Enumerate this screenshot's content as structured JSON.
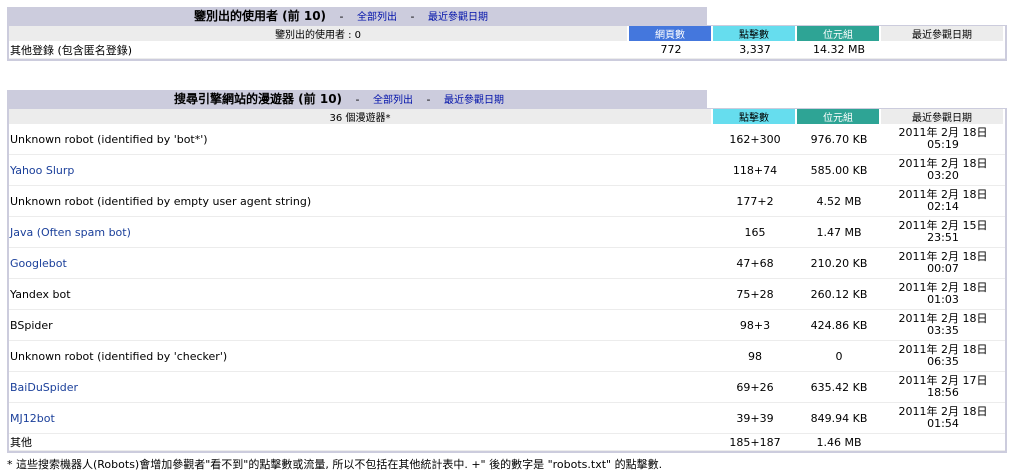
{
  "users_section": {
    "title": "鑒別出的使用者 (前 10)",
    "sep1": "-",
    "link_full": "全部列出",
    "sep2": "-",
    "link_last": "最近參觀日期",
    "header_label": "鑒別出的使用者 : 0",
    "col_pages": "網頁數",
    "col_hits": "點擊數",
    "col_bandwidth": "位元組",
    "col_last": "最近參觀日期",
    "other_row": {
      "label": "其他登錄 (包含匿名登錄)",
      "pages": "772",
      "hits": "3,337",
      "bandwidth": "14.32 MB",
      "last": ""
    }
  },
  "robots_section": {
    "title": "搜尋引擎網站的漫遊器 (前 10)",
    "sep1": "-",
    "link_full": "全部列出",
    "sep2": "-",
    "link_last": "最近參觀日期",
    "header_label": "36 個漫遊器*",
    "col_hits": "點擊數",
    "col_bandwidth": "位元組",
    "col_last": "最近參觀日期",
    "rows": [
      {
        "name": "Unknown robot (identified by 'bot*')",
        "link": false,
        "hits": "162+300",
        "bandwidth": "976.70 KB",
        "date": "2011年 2月 18日",
        "time": "05:19"
      },
      {
        "name": "Yahoo Slurp",
        "link": true,
        "hits": "118+74",
        "bandwidth": "585.00 KB",
        "date": "2011年 2月 18日",
        "time": "03:20"
      },
      {
        "name": "Unknown robot (identified by empty user agent string)",
        "link": false,
        "hits": "177+2",
        "bandwidth": "4.52 MB",
        "date": "2011年 2月 18日",
        "time": "02:14"
      },
      {
        "name": "Java (Often spam bot)",
        "link": true,
        "hits": "165",
        "bandwidth": "1.47 MB",
        "date": "2011年 2月 15日",
        "time": "23:51"
      },
      {
        "name": "Googlebot",
        "link": true,
        "hits": "47+68",
        "bandwidth": "210.20 KB",
        "date": "2011年 2月 18日",
        "time": "00:07"
      },
      {
        "name": "Yandex bot",
        "link": false,
        "hits": "75+28",
        "bandwidth": "260.12 KB",
        "date": "2011年 2月 18日",
        "time": "01:03"
      },
      {
        "name": "BSpider",
        "link": false,
        "hits": "98+3",
        "bandwidth": "424.86 KB",
        "date": "2011年 2月 18日",
        "time": "03:35"
      },
      {
        "name": "Unknown robot (identified by 'checker')",
        "link": false,
        "hits": "98",
        "bandwidth": "0",
        "date": "2011年 2月 18日",
        "time": "06:35"
      },
      {
        "name": "BaiDuSpider",
        "link": true,
        "hits": "69+26",
        "bandwidth": "635.42 KB",
        "date": "2011年 2月 17日",
        "time": "18:56"
      },
      {
        "name": "MJ12bot",
        "link": true,
        "hits": "39+39",
        "bandwidth": "849.94 KB",
        "date": "2011年 2月 18日",
        "time": "01:54"
      }
    ],
    "other_row": {
      "label": "其他",
      "hits": "185+187",
      "bandwidth": "1.46 MB",
      "last": ""
    }
  },
  "footnote": "* 這些搜索機器人(Robots)會增加參觀者\"看不到\"的點擊數或流量, 所以不包括在其他統計表中. +\" 後的數字是 \"robots.txt\" 的點擊數.",
  "colors": {
    "pages": "#4477dd",
    "hits": "#66ddee",
    "bandwidth": "#2ea495",
    "title_bg": "#ccccdd",
    "link": "#1a3f9a"
  }
}
